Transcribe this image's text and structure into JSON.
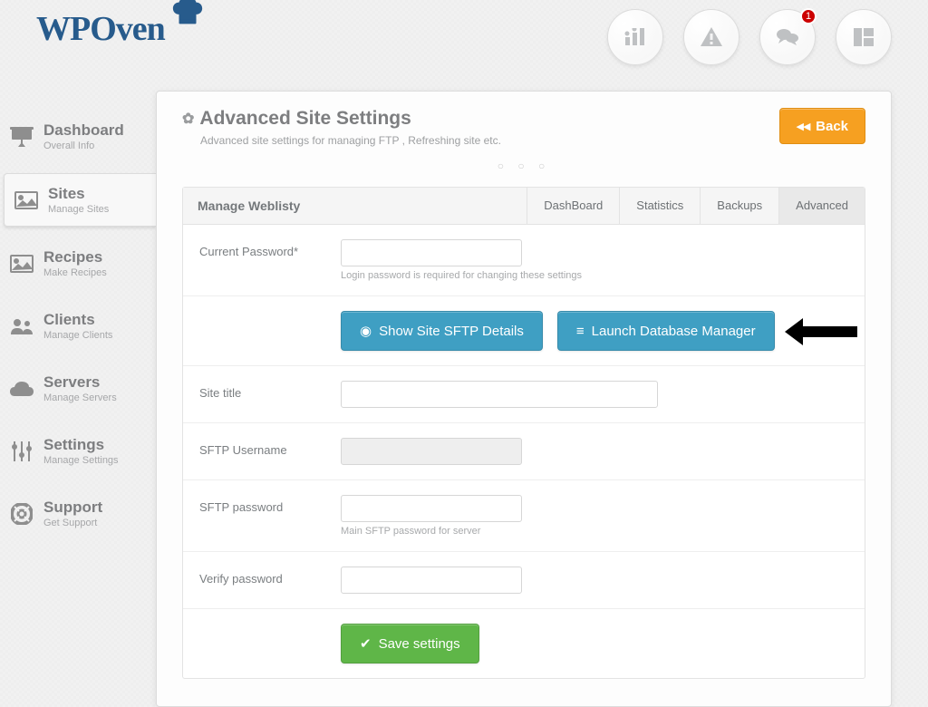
{
  "brand": "WPOven",
  "notification_badge": "1",
  "sidebar": {
    "items": [
      {
        "label": "Dashboard",
        "sub": "Overall Info"
      },
      {
        "label": "Sites",
        "sub": "Manage Sites"
      },
      {
        "label": "Recipes",
        "sub": "Make Recipes"
      },
      {
        "label": "Clients",
        "sub": "Manage Clients"
      },
      {
        "label": "Servers",
        "sub": "Manage Servers"
      },
      {
        "label": "Settings",
        "sub": "Manage Settings"
      },
      {
        "label": "Support",
        "sub": "Get Support"
      }
    ]
  },
  "page": {
    "title": "Advanced Site Settings",
    "subtitle": "Advanced site settings for managing FTP , Refreshing site etc.",
    "back": "Back"
  },
  "panel": {
    "title": "Manage Weblisty",
    "tabs": [
      "DashBoard",
      "Statistics",
      "Backups",
      "Advanced"
    ]
  },
  "form": {
    "current_password_label": "Current Password*",
    "current_password_hint": "Login password is required for changing these settings",
    "show_sftp_btn": "Show Site SFTP Details",
    "launch_db_btn": "Launch Database Manager",
    "site_title_label": "Site title",
    "sftp_username_label": "SFTP Username",
    "sftp_password_label": "SFTP password",
    "sftp_password_hint": "Main SFTP password for server",
    "verify_password_label": "Verify password",
    "save_btn": "Save settings"
  }
}
